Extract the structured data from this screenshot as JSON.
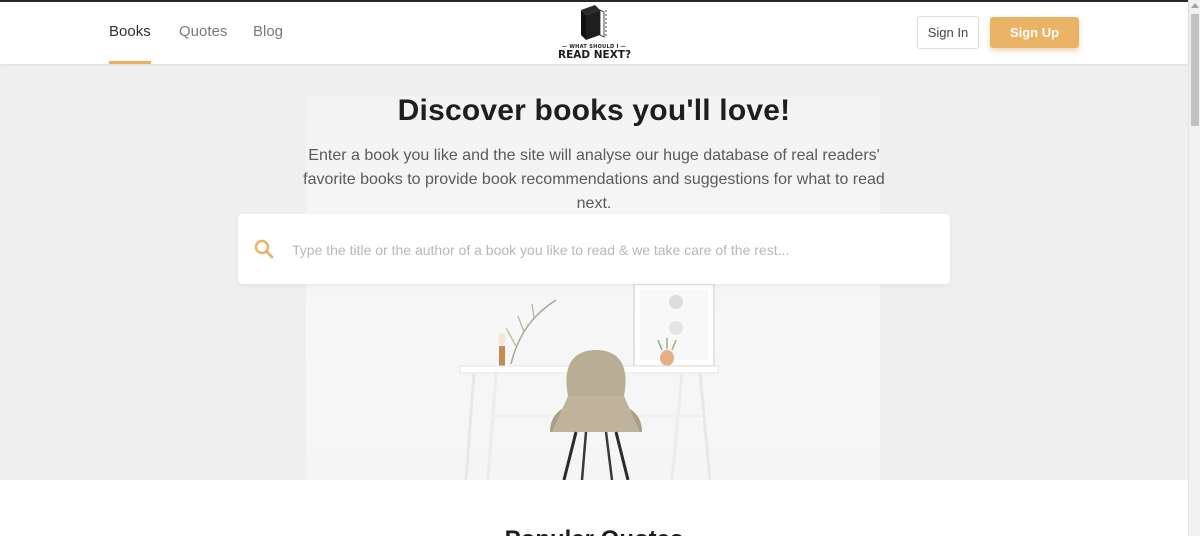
{
  "header": {
    "nav": [
      {
        "label": "Books",
        "active": true
      },
      {
        "label": "Quotes",
        "active": false
      },
      {
        "label": "Blog",
        "active": false
      }
    ],
    "logo": {
      "small_text": "— WHAT SHOULD I —",
      "big_text": "READ NEXT?"
    },
    "sign_in_label": "Sign In",
    "sign_up_label": "Sign Up"
  },
  "hero": {
    "title": "Discover books you'll love!",
    "subtitle": "Enter a book you like and the site will analyse our huge database of real readers' favorite books to provide book recommendations and suggestions for what to read next.",
    "search": {
      "value": "",
      "placeholder": "Type the title or the author of a book you like to read & we take care of the rest..."
    }
  },
  "lower": {
    "heading_partial": "Popular Quotes"
  },
  "colors": {
    "accent": "#eab365",
    "hero_bg": "#efefef",
    "text_dark": "#1e1e1e",
    "text_muted": "#5a5a5a",
    "nav_muted": "#7a7a7a"
  },
  "icons": {
    "search": "search-icon",
    "logo": "book-logo-icon"
  }
}
